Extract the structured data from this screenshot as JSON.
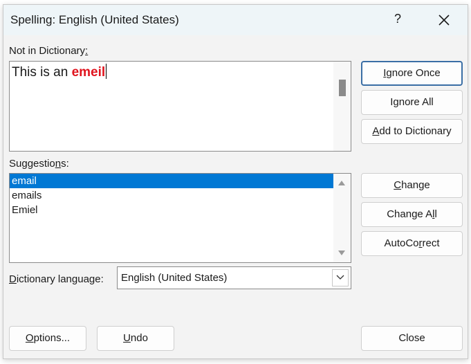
{
  "window": {
    "title": "Spelling: English (United States)",
    "help_glyph": "?"
  },
  "not_in_dictionary": {
    "label_pre": "Not in Dictionary",
    "label_underlined": ":",
    "text_plain": "This is an ",
    "text_error": "emeil"
  },
  "suggestions": {
    "label_pre": "Suggestio",
    "label_underlined": "n",
    "label_post": "s:",
    "items": [
      "email",
      "emails",
      "Emiel"
    ],
    "selected_index": 0
  },
  "dictionary_language": {
    "label_underlined": "D",
    "label_post": "ictionary language:",
    "value": "English (United States)"
  },
  "buttons": {
    "ignore_once": {
      "u": "I",
      "rest": "gnore Once"
    },
    "ignore_all": {
      "pre": "I",
      "u": "g",
      "rest": "nore All"
    },
    "add_to_dictionary": {
      "u": "A",
      "rest": "dd to Dictionary"
    },
    "change": {
      "u": "C",
      "rest": "hange"
    },
    "change_all": {
      "pre": "Change A",
      "u": "l",
      "rest": "l"
    },
    "autocorrect": {
      "pre": "AutoCo",
      "u": "r",
      "rest": "rect"
    },
    "options": {
      "u": "O",
      "rest": "ptions..."
    },
    "undo": {
      "u": "U",
      "rest": "ndo"
    },
    "close": "Close"
  }
}
